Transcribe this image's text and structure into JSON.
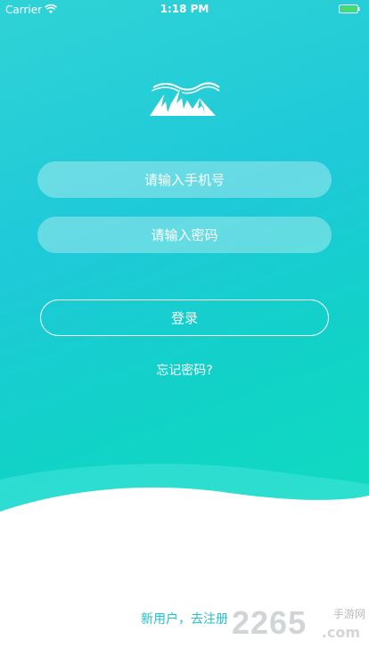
{
  "status_bar": {
    "carrier": "Carrier",
    "time": "1:18 PM",
    "wifi_icon": "wifi-icon",
    "battery_icon": "battery-icon",
    "battery_color": "#4cd964"
  },
  "logo": {
    "icon": "mountain-logo-icon"
  },
  "login_form": {
    "phone_placeholder": "请输入手机号",
    "password_placeholder": "请输入密码",
    "login_label": "登录",
    "forgot_label": "忘记密码?"
  },
  "footer": {
    "register_label": "新用户，去注册"
  },
  "watermark": {
    "brand": "2265",
    "domain": ".com",
    "tagline": "手游网"
  },
  "colors": {
    "gradient_top": "#2fd3d6",
    "gradient_bottom": "#0de3b8",
    "register_text": "#21c2c7"
  }
}
